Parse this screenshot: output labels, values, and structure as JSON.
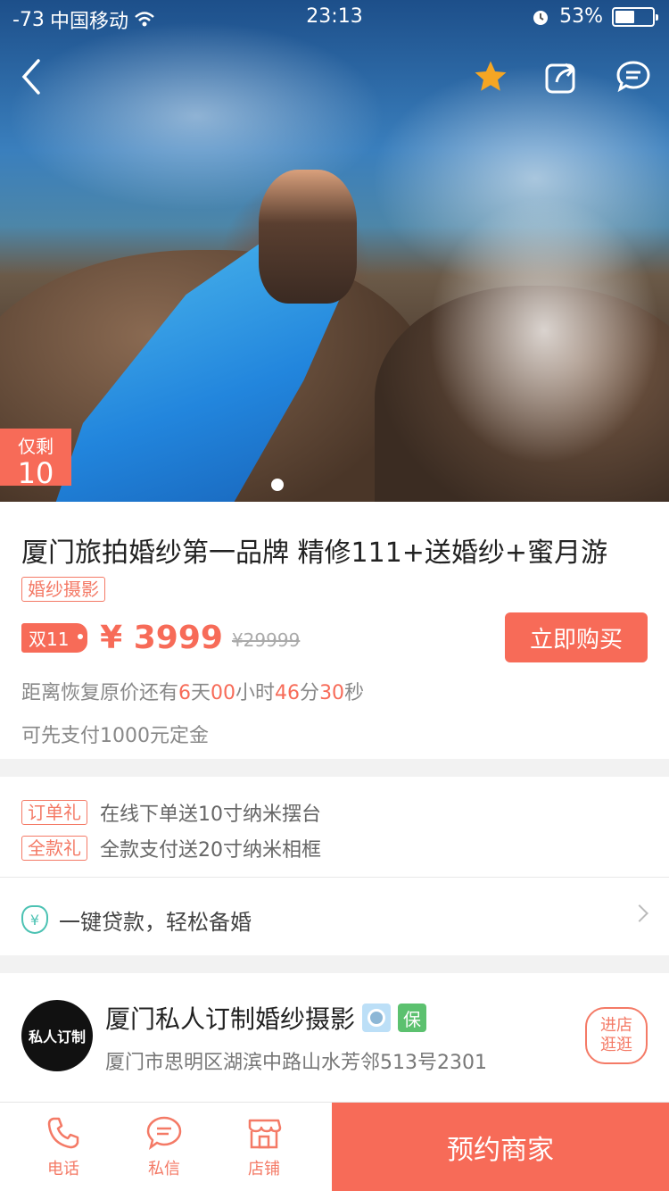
{
  "status_bar": {
    "signal": "-73",
    "carrier": "中国移动",
    "time": "23:13",
    "battery_percent": "53%",
    "battery_level": 0.53
  },
  "hero": {
    "stock_label": "仅剩",
    "stock_count": "10",
    "page_indicator": {
      "current": 1,
      "total": 1
    }
  },
  "product": {
    "title": "厦门旅拍婚纱第一品牌 精修111+送婚纱+蜜月游",
    "category_tag": "婚纱摄影",
    "promo_tag": "双11",
    "price": "¥ 3999",
    "original_price": "¥29999",
    "buy_button": "立即购买",
    "countdown": {
      "prefix": "距离恢复原价还有",
      "days": "6",
      "days_unit": "天",
      "hours": "00",
      "hours_unit": "小时",
      "minutes": "46",
      "minutes_unit": "分",
      "seconds": "30",
      "seconds_unit": "秒"
    },
    "deposit_note": "可先支付1000元定金"
  },
  "gifts": [
    {
      "tag": "订单礼",
      "text": "在线下单送10寸纳米摆台"
    },
    {
      "tag": "全款礼",
      "text": "全款支付送20寸纳米相框"
    }
  ],
  "loan": {
    "icon_glyph": "¥",
    "text": "一键贷款，轻松备婚"
  },
  "merchant": {
    "logo_text": "私人订制",
    "name": "厦门私人订制婚纱摄影",
    "bao_badge": "保",
    "address": "厦门市思明区湖滨中路山水芳邻513号2301",
    "visit_line1": "进店",
    "visit_line2": "逛逛"
  },
  "bottom_bar": {
    "phone": "电话",
    "message": "私信",
    "store": "店铺",
    "reserve": "预约商家"
  },
  "colors": {
    "accent": "#f76b58",
    "star": "#f5a623",
    "teal": "#4cc2b3"
  }
}
